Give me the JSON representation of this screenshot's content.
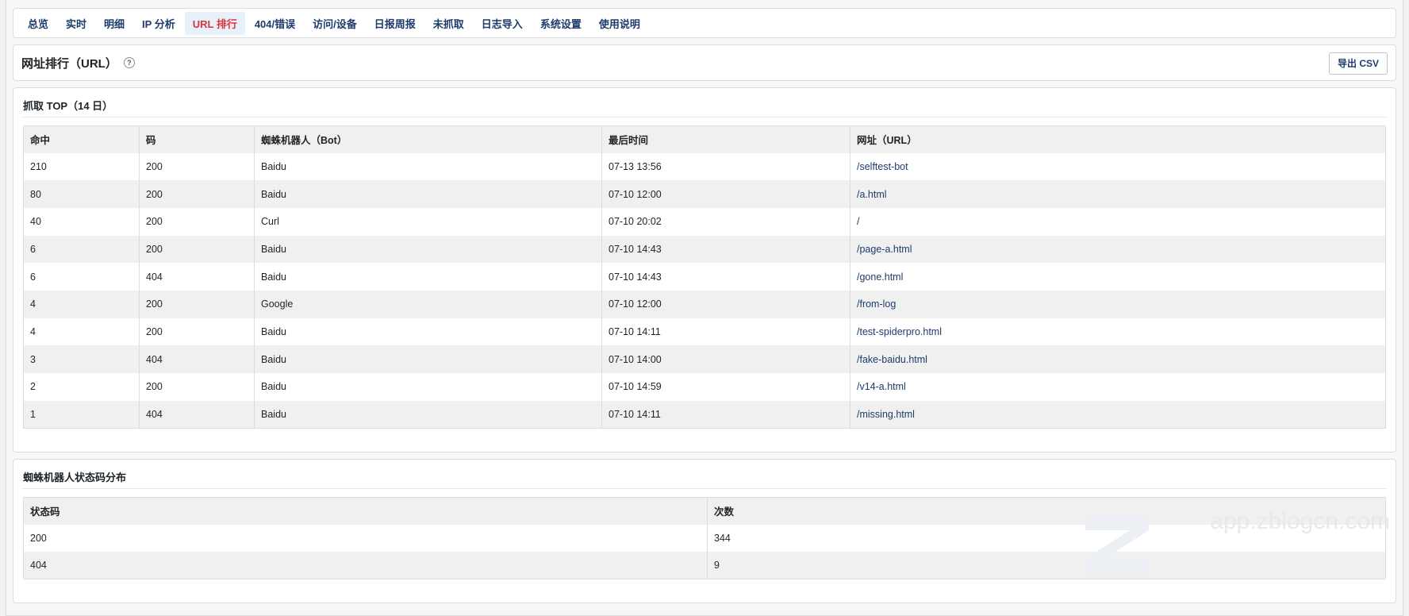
{
  "nav": {
    "tabs": [
      {
        "label": "总览",
        "name": "tab-overview"
      },
      {
        "label": "实时",
        "name": "tab-realtime"
      },
      {
        "label": "明细",
        "name": "tab-details"
      },
      {
        "label": "IP 分析",
        "name": "tab-ip-analysis"
      },
      {
        "label": "URL 排行",
        "name": "tab-url-ranking",
        "active": true
      },
      {
        "label": "404/错误",
        "name": "tab-404-errors"
      },
      {
        "label": "访问/设备",
        "name": "tab-visits-devices"
      },
      {
        "label": "日报周报",
        "name": "tab-reports"
      },
      {
        "label": "未抓取",
        "name": "tab-not-crawled"
      },
      {
        "label": "日志导入",
        "name": "tab-log-import"
      },
      {
        "label": "系统设置",
        "name": "tab-settings"
      },
      {
        "label": "使用说明",
        "name": "tab-help"
      }
    ]
  },
  "header": {
    "title": "网址排行（URL）",
    "help_icon": "question-icon",
    "help_glyph": "?",
    "export_label": "导出 CSV"
  },
  "top_section": {
    "title": "抓取 TOP（14 日）",
    "columns": [
      "命中",
      "码",
      "蜘蛛机器人（Bot）",
      "最后时间",
      "网址（URL）"
    ],
    "rows": [
      {
        "hits": "210",
        "code": "200",
        "bot": "Baidu",
        "last_time": "07-13 13:56",
        "url": "/selftest-bot"
      },
      {
        "hits": "80",
        "code": "200",
        "bot": "Baidu",
        "last_time": "07-10 12:00",
        "url": "/a.html"
      },
      {
        "hits": "40",
        "code": "200",
        "bot": "Curl",
        "last_time": "07-10 20:02",
        "url": "/"
      },
      {
        "hits": "6",
        "code": "200",
        "bot": "Baidu",
        "last_time": "07-10 14:43",
        "url": "/page-a.html"
      },
      {
        "hits": "6",
        "code": "404",
        "bot": "Baidu",
        "last_time": "07-10 14:43",
        "url": "/gone.html"
      },
      {
        "hits": "4",
        "code": "200",
        "bot": "Google",
        "last_time": "07-10 12:00",
        "url": "/from-log"
      },
      {
        "hits": "4",
        "code": "200",
        "bot": "Baidu",
        "last_time": "07-10 14:11",
        "url": "/test-spiderpro.html"
      },
      {
        "hits": "3",
        "code": "404",
        "bot": "Baidu",
        "last_time": "07-10 14:00",
        "url": "/fake-baidu.html"
      },
      {
        "hits": "2",
        "code": "200",
        "bot": "Baidu",
        "last_time": "07-10 14:59",
        "url": "/v14-a.html"
      },
      {
        "hits": "1",
        "code": "404",
        "bot": "Baidu",
        "last_time": "07-10 14:11",
        "url": "/missing.html"
      }
    ]
  },
  "status_section": {
    "title": "蜘蛛机器人状态码分布",
    "columns": [
      "状态码",
      "次数"
    ],
    "rows": [
      {
        "code": "200",
        "count": "344"
      },
      {
        "code": "404",
        "count": "9"
      }
    ]
  },
  "watermark": {
    "text": "app.zblogcn.com"
  },
  "colors": {
    "accent": "#1d3c6b",
    "active_tab": "#d63638",
    "stripe": "#f0f0f1",
    "border": "#dcdcde"
  }
}
